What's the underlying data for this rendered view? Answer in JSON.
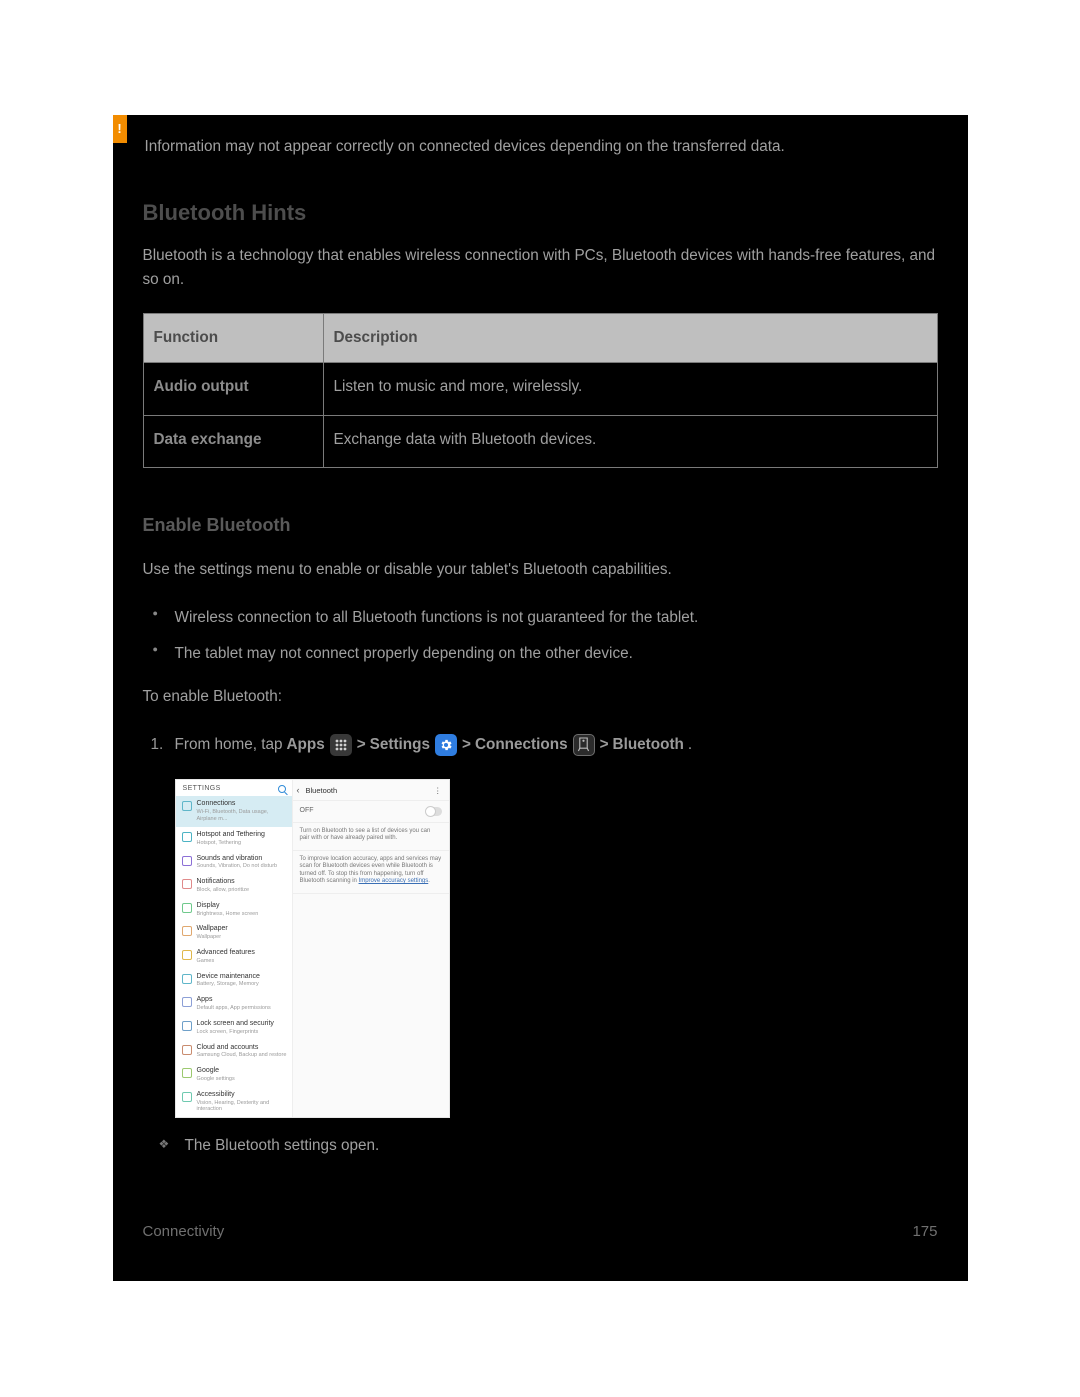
{
  "warning": {
    "icon_glyph": "!",
    "text": "Information may not appear correctly on connected devices depending on the transferred data."
  },
  "hints_title": "Bluetooth Hints",
  "hints_para": "Bluetooth is a technology that enables wireless connection with PCs, Bluetooth devices with hands-free features, and so on.",
  "table": {
    "head_function": "Function",
    "head_description": "Description",
    "rows": [
      {
        "fn": "Audio output",
        "desc": "Listen to music and more, wirelessly."
      },
      {
        "fn": "Data exchange",
        "desc": "Exchange data with Bluetooth devices."
      }
    ]
  },
  "enable_title": "Enable Bluetooth",
  "enable_para": "Use the settings menu to enable or disable your tablet's Bluetooth capabilities.",
  "enable_bullets": [
    "Wireless connection to all Bluetooth functions is not guaranteed for the tablet.",
    "The tablet may not connect properly depending on the other device."
  ],
  "to_enable_label": "To enable Bluetooth:",
  "step1": {
    "num": "1.",
    "pre": "From home, tap ",
    "apps": "Apps",
    "sep1": " > ",
    "settings": "Settings",
    "sep2": " > ",
    "connections": "Connections",
    "sep3": " > ",
    "bluetooth": "Bluetooth",
    "tail": "."
  },
  "result_line": "The Bluetooth settings open.",
  "footer": {
    "left": "Connectivity",
    "right": "175"
  },
  "screenshot": {
    "left_header": "SETTINGS",
    "right_header": "Bluetooth",
    "off_label": "OFF",
    "info1": "Turn on Bluetooth to see a list of devices you can pair with or have already paired with.",
    "info2_a": "To improve location accuracy, apps and services may scan for Bluetooth devices even while Bluetooth is turned off. To stop this from happening, turn off Bluetooth scanning in ",
    "info2_link": "Improve accuracy settings",
    "info2_b": ".",
    "menu": [
      {
        "t": "Connections",
        "s": "Wi-Fi, Bluetooth, Data usage, Airplane m...",
        "c": "#5fb6c9",
        "sel": true
      },
      {
        "t": "Hotspot and Tethering",
        "s": "Hotspot, Tethering",
        "c": "#4cb3c4"
      },
      {
        "t": "Sounds and vibration",
        "s": "Sounds, Vibration, Do not disturb",
        "c": "#8c6fd6"
      },
      {
        "t": "Notifications",
        "s": "Block, allow, prioritize",
        "c": "#e08a8a"
      },
      {
        "t": "Display",
        "s": "Brightness, Home screen",
        "c": "#6fc98c"
      },
      {
        "t": "Wallpaper",
        "s": "Wallpaper",
        "c": "#e0a86f"
      },
      {
        "t": "Advanced features",
        "s": "Games",
        "c": "#e0b84c"
      },
      {
        "t": "Device maintenance",
        "s": "Battery, Storage, Memory",
        "c": "#5fb6c9"
      },
      {
        "t": "Apps",
        "s": "Default apps, App permissions",
        "c": "#8c9fd6"
      },
      {
        "t": "Lock screen and security",
        "s": "Lock screen, Fingerprints",
        "c": "#6fa0c9"
      },
      {
        "t": "Cloud and accounts",
        "s": "Samsung Cloud, Backup and restore",
        "c": "#c98c6f"
      },
      {
        "t": "Google",
        "s": "Google settings",
        "c": "#9cc96f"
      },
      {
        "t": "Accessibility",
        "s": "Vision, Hearing, Dexterity and interaction",
        "c": "#6fc9b0"
      }
    ]
  }
}
